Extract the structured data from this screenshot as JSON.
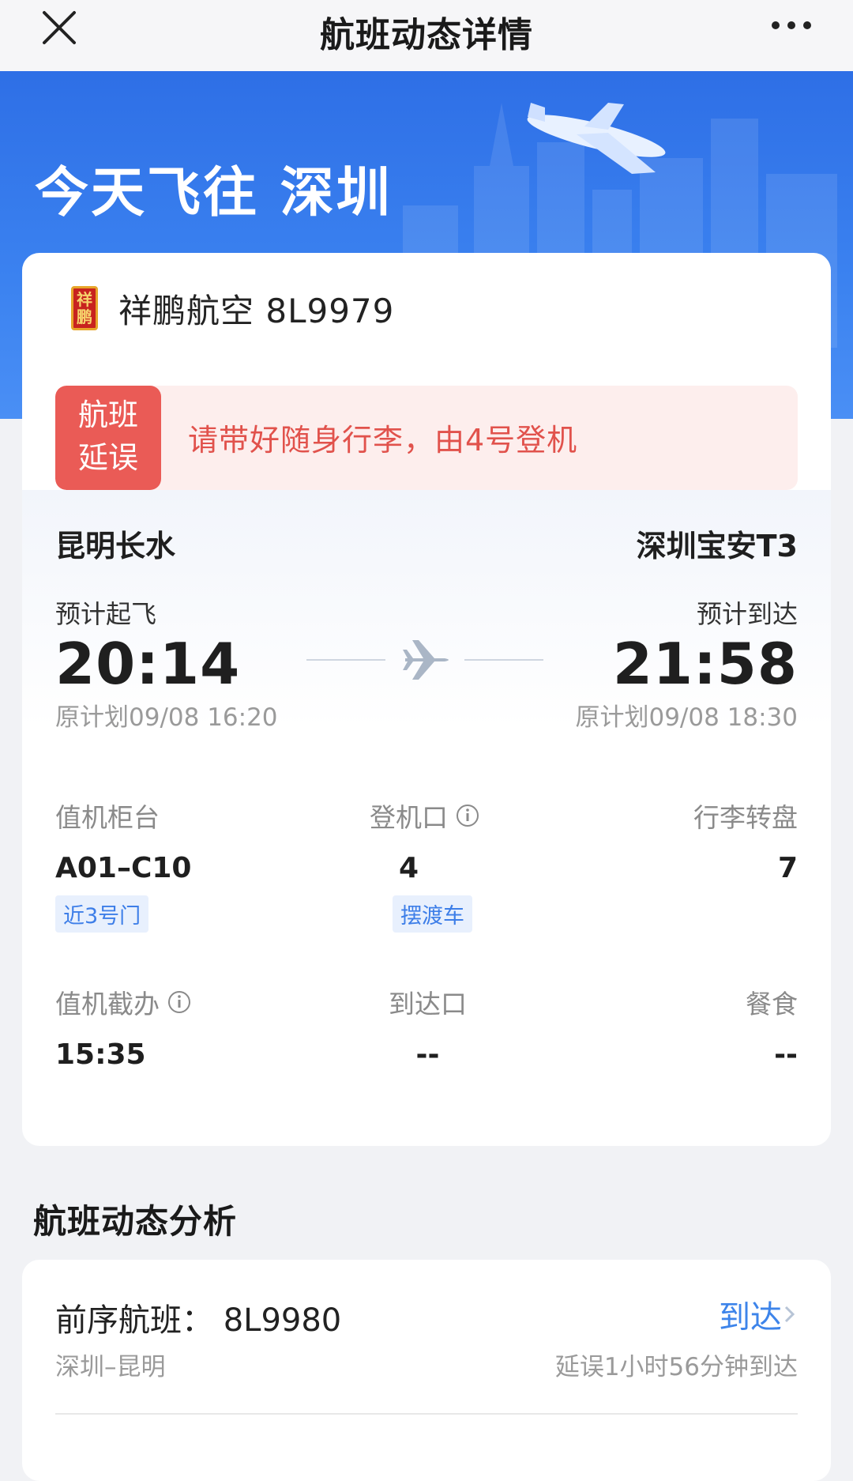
{
  "nav": {
    "title": "航班动态详情"
  },
  "hero": {
    "title": "今天飞往 深圳"
  },
  "flight": {
    "airline_flight": "祥鹏航空 8L9979",
    "logo_text": "祥鹏"
  },
  "alert": {
    "badge_line1": "航班",
    "badge_line2": "延误",
    "message": "请带好随身行李，由4号登机"
  },
  "route": {
    "departure_airport": "昆明长水",
    "arrival_airport": "深圳宝安T3",
    "dep_label": "预计起飞",
    "dep_time": "20:14",
    "dep_original": "原计划09/08 16:20",
    "arr_label": "预计到达",
    "arr_time": "21:58",
    "arr_original": "原计划09/08 18:30"
  },
  "info": {
    "checkin_counter_label": "值机柜台",
    "checkin_counter_value": "A01–C10",
    "checkin_counter_tag": "近3号门",
    "gate_label": "登机口",
    "gate_value": "4",
    "gate_tag": "摆渡车",
    "baggage_label": "行李转盘",
    "baggage_value": "7",
    "checkin_deadline_label": "值机截办",
    "checkin_deadline_value": "15:35",
    "arrival_gate_label": "到达口",
    "arrival_gate_value": "--",
    "meal_label": "餐食",
    "meal_value": "--"
  },
  "analysis": {
    "section_title": "航班动态分析",
    "prev_flight": "前序航班：  8L9980",
    "prev_route": "深圳–昆明",
    "prev_status": "到达",
    "prev_delay": "延误1小时56分钟到达"
  },
  "colors": {
    "brand_blue": "#2e6fe6",
    "alert_red": "#ea5b56",
    "link_blue": "#3d84ea"
  }
}
